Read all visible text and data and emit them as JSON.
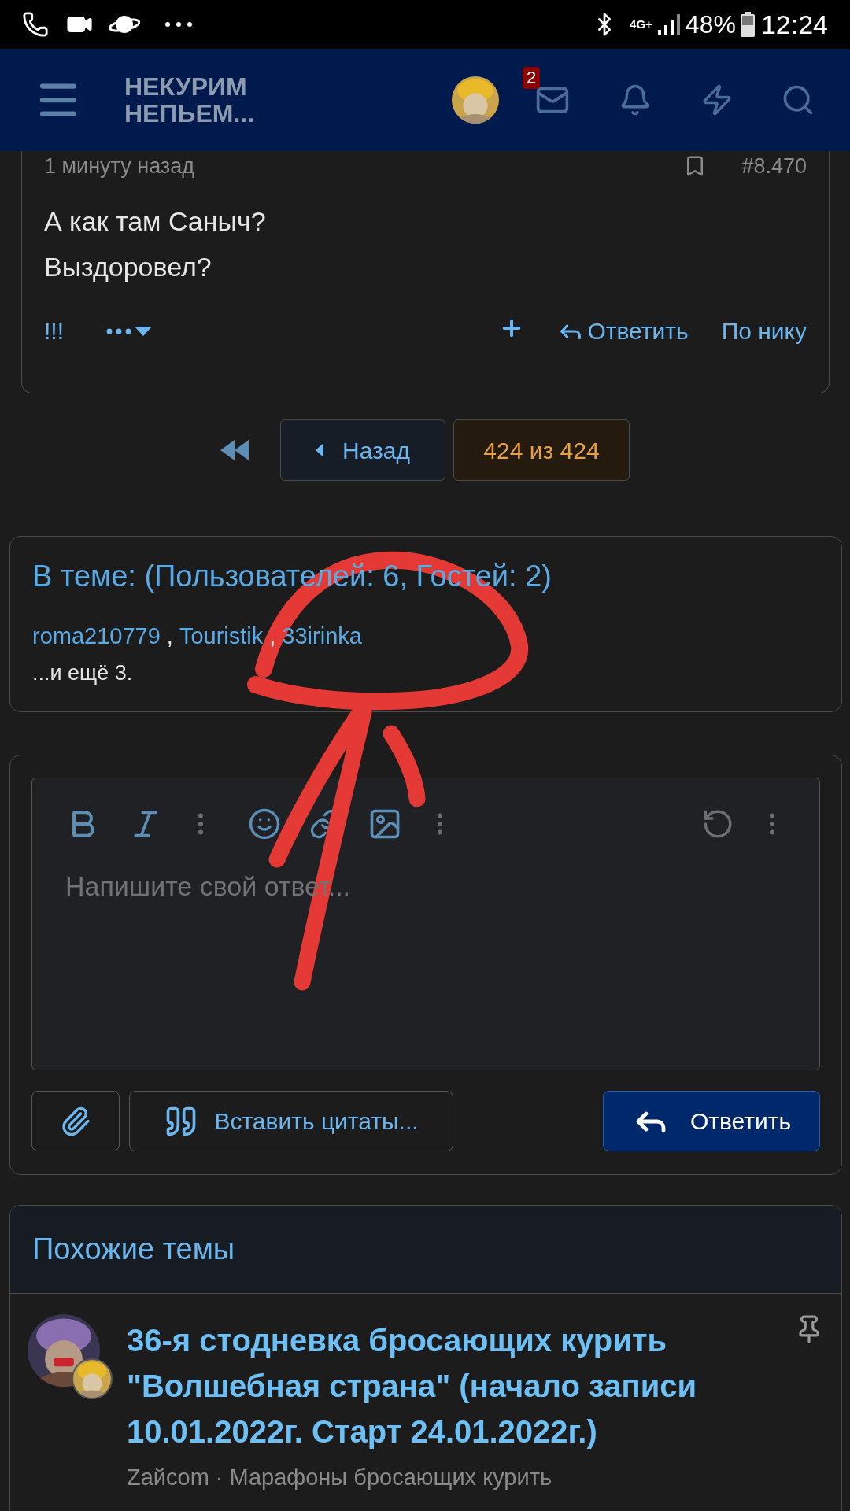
{
  "status_bar": {
    "network": "4G+",
    "battery": "48%",
    "time": "12:24"
  },
  "header": {
    "logo_lines": [
      "НЕКУРИМ",
      "НЕПЬЕМ..."
    ],
    "mail_badge": "2"
  },
  "post": {
    "time": "1 минуту назад",
    "number": "#8.470",
    "lines": [
      "А как там Саныч?",
      "Выздоровел?"
    ],
    "actions": [
      {
        "kind": "text",
        "label": "!!!"
      },
      {
        "kind": "more"
      },
      {
        "kind": "plus"
      },
      {
        "kind": "reply",
        "label": "Ответить"
      },
      {
        "kind": "text",
        "label": "По нику"
      }
    ]
  },
  "pagination": {
    "back": "Назад",
    "pages": [
      {
        "label": "424 из 424",
        "selected": true
      }
    ]
  },
  "online": {
    "title": "В теме: (Пользователей: 6, Гостей: 2)",
    "users": [
      "roma210779",
      "Touristik",
      "33irinka"
    ],
    "user_separator": ",",
    "more": "...и ещё 3."
  },
  "editor": {
    "placeholder": "Напишите свой ответ...",
    "insert_quotes": "Вставить цитаты...",
    "submit": "Ответить"
  },
  "similar": {
    "title": "Похожие темы",
    "threads": [
      {
        "title": "36-я стодневка бросающих курить \"Волшебная страна\" (начало записи 10.01.2022г. Старт 24.01.2022г.)",
        "author": "Zaйcom",
        "separator": "·",
        "forum": "Марафоны бросающих курить",
        "pinned": true
      }
    ]
  }
}
